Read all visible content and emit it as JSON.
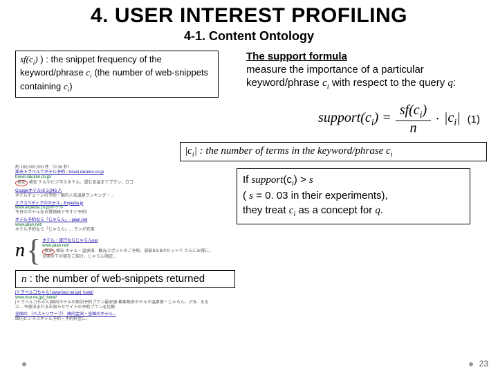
{
  "title": "4. USER INTEREST PROFILING",
  "subtitle": "4-1. Content Ontology",
  "sf_def": {
    "lead": "sf(c",
    "sub": "i",
    "mid": ") : the snippet frequency of the keyword/phrase ",
    "c": "c",
    "tail": " (the number of web-snippets containing ",
    "tail2": ")"
  },
  "support": {
    "head": "The support formula",
    "body1": "measure the importance of a particular keyword/phrase ",
    "c": "c",
    "csub": "i",
    "body2": " with respect to the query ",
    "q": "q",
    "body3": ":"
  },
  "formula": {
    "lhs1": "support(c",
    "lhs_sub": "i",
    "lhs2": ") = ",
    "num1": "sf(c",
    "num_sub": "i",
    "num2": ")",
    "den": "n",
    "dot": " · ",
    "rhs1": "|c",
    "rhs_sub": "i",
    "rhs2": "|",
    "eqnum": "(1)"
  },
  "ci_def": {
    "a": "|c",
    "sub": "i",
    "b": "| : the number of terms in the keyword/phrase ",
    "c": "c"
  },
  "n_sym": "n",
  "n_def": {
    "a": "n",
    "b": " : the number of web-snippets returned"
  },
  "conclusion": {
    "l1a": "If ",
    "l1b": "support",
    "l1c": "(c",
    "l1sub": "i",
    "l1d": ") > ",
    "l1e": "s",
    "l2a": "( ",
    "l2b": "s",
    "l2c": " = 0. 03 in their experiments),",
    "l3a": "they treat ",
    "l3b": "c",
    "l3sub": "i",
    "l3c": " as a concept for ",
    "l3d": "q",
    "l3e": "."
  },
  "mock": {
    "stats": "約 165,000,000 件 （0.38 秒）",
    "r": [
      {
        "t": "楽天トラベルでホテル予約 - travel.rakuten.co.jp",
        "u": "travel.rakuten.co.jp/",
        "d": "格安 テルやビジネスホテル、望む気温までプラン、ロコ"
      },
      {
        "t": "Googleホテルは 3,046 人",
        "u": "",
        "d": "ホテルチェーンの予約・国内人気温泉ランキング・..."
      },
      {
        "t": "エクスペディアのホテル - Expedia.jp",
        "u": "www.expedia.co.jp/ホテル",
        "d": "今日のホテルをお得価格で今すぐ予約！"
      },
      {
        "t": "ホテル予約なら「じゃらん」- jalan.net",
        "u": "www.jalan.net/",
        "d": "ホテル予約なら「じゃらん」... ランが充実"
      },
      {
        "t": "ホテル・旅行ならじゃらんnet",
        "u": "www.jalan.net/",
        "d": "格安 ホテル・温泉宿、観光スポットのご予約、旅館B＆Bのセットで さらにお得に。全国全ての宿をご紹介、じゃらん限定..."
      },
      {
        "t": "[トラベルコちゃん] www.tour.ne.jp/j_hotel/",
        "u": "www.tour.ne.jp/j_hotel/",
        "d": "[トラベルコちゃん]国内ホテルの宿泊予約プラン最安値 検索格安ホテルや温泉宿・じゃらん、JTB、るるぶ... 今夜泊まれるお知らせサイトの予約プランを比較"
      },
      {
        "t": "全国の （ベストリザーブ） 国内金沢・全国のホテル...",
        "u": "",
        "d": "国内ビジネスホテル予約・予約料金に。"
      }
    ],
    "circ1": "格安",
    "circ2": "格安"
  },
  "pagenum": "23"
}
